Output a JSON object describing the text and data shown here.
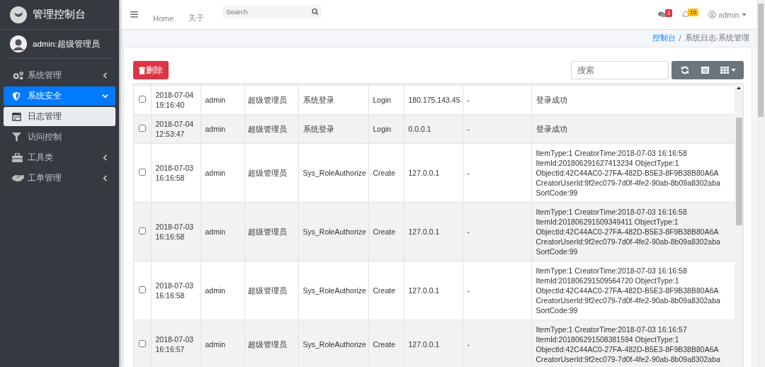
{
  "app": {
    "title": "管理控制台"
  },
  "user": {
    "name": "admin:超级管理员"
  },
  "sidebar": {
    "items": [
      {
        "label": "系统管理",
        "selected": false,
        "expanded": false
      },
      {
        "label": "系统安全",
        "selected": true,
        "expanded": true,
        "children": [
          {
            "label": "日志管理",
            "selected": true
          }
        ]
      },
      {
        "label": "访问控制",
        "selected": false
      },
      {
        "label": "工具类",
        "selected": false,
        "expanded": false
      },
      {
        "label": "工单管理",
        "selected": false,
        "expanded": false
      }
    ]
  },
  "navbar": {
    "links": [
      "Home",
      "关于"
    ],
    "search": {
      "placeholder": "Search"
    },
    "messages_badge": "3",
    "notifications_badge": "15",
    "account": "admin"
  },
  "breadcrumb": [
    "控制台",
    "系统日志-系统管理"
  ],
  "breadcrumb_separator": "/",
  "toolbar": {
    "delete_button": "删除",
    "search": {
      "placeholder": "搜索"
    }
  },
  "table": {
    "rows": [
      {
        "checked": false,
        "time": "2018-07-04\n19:16:40",
        "user": "admin",
        "role": "超级管理员",
        "module": "系统登录",
        "operation": "Login",
        "ip": "180.175.143.45",
        "column_8": "-",
        "message": "登录成功"
      },
      {
        "checked": false,
        "time": "2018-07-04\n12:53:47",
        "user": "admin",
        "role": "超级管理员",
        "module": "系统登录",
        "operation": "Login",
        "ip": "0.0.0.1",
        "column_8": "-",
        "message": "登录成功"
      },
      {
        "checked": false,
        "time": "2018-07-03\n16:16:58",
        "user": "admin",
        "role": "超级管理员",
        "module": "Sys_RoleAuthorize",
        "operation": "Create",
        "ip": "127.0.0.1",
        "column_8": "-",
        "message": "ItemType:1 CreatorTime:2018-07-03 16:16:58\nItemId:201806291627413234 ObjectType:1\nObjectId:42C44AC0-27FA-482D-B5E3-8F9B38B80A6A\nCreatorUserId:9f2ec079-7d0f-4fe2-90ab-8b09a8302aba\nSortCode:99"
      },
      {
        "checked": false,
        "time": "2018-07-03\n16:16:58",
        "user": "admin",
        "role": "超级管理员",
        "module": "Sys_RoleAuthorize",
        "operation": "Create",
        "ip": "127.0.0.1",
        "column_8": "-",
        "message": "ItemType:1 CreatorTime:2018-07-03 16:16:58\nItemId:201806291509349411 ObjectType:1\nObjectId:42C44AC0-27FA-482D-B5E3-8F9B38B80A6A\nCreatorUserId:9f2ec079-7d0f-4fe2-90ab-8b09a8302aba\nSortCode:99"
      },
      {
        "checked": false,
        "time": "2018-07-03\n16:16:58",
        "user": "admin",
        "role": "超级管理员",
        "module": "Sys_RoleAuthorize",
        "operation": "Create",
        "ip": "127.0.0.1",
        "column_8": "-",
        "message": "ItemType:1 CreatorTime:2018-07-03 16:16:58\nItemId:201806291509564720 ObjectType:1\nObjectId:42C44AC0-27FA-482D-B5E3-8F9B38B80A6A\nCreatorUserId:9f2ec079-7d0f-4fe2-90ab-8b09a8302aba\nSortCode:99"
      },
      {
        "checked": false,
        "time": "2018-07-03\n16:16:57",
        "user": "admin",
        "role": "超级管理员",
        "module": "Sys_RoleAuthorize",
        "operation": "Create",
        "ip": "127.0.0.1",
        "column_8": "-",
        "message": "ItemType:1 CreatorTime:2018-07-03 16:16:57\nItemId:201806291508381594 ObjectType:1\nObjectId:42C44AC0-27FA-482D-B5E3-8F9B38B80A6A\nCreatorUserId:9f2ec079-7d0f-4fe2-90ab-8b09a8302aba"
      }
    ]
  }
}
